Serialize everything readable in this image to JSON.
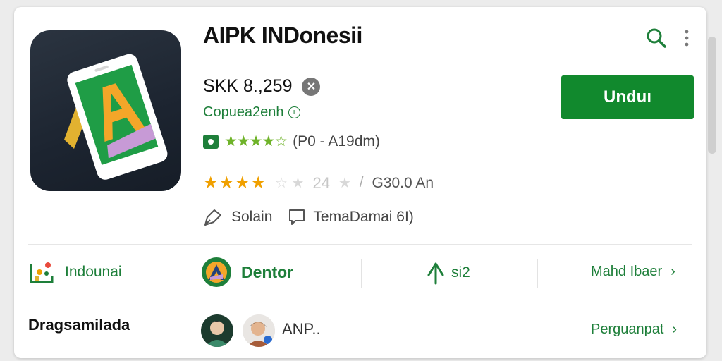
{
  "app": {
    "title": "AIPK INDonesii",
    "price": "SKK 8.,259",
    "developer": "Copuea2enh",
    "reviews": "(P0 - A19dm)",
    "rating_faint_number": "24",
    "downloads": "G30.0 An",
    "install_label": "Unduı"
  },
  "actions": {
    "share_label": "Solain",
    "comment_label": "TemaDamai 6I)"
  },
  "stats": {
    "item1_label": "Indounai",
    "item2_label": "Dentor",
    "item3_label": "si2",
    "more_label": "Mahd Ibaer"
  },
  "section": {
    "title": "Dragsamilada",
    "avatar_text": "ANP..",
    "more_label": "Perguanpat"
  },
  "colors": {
    "accent_green": "#11892d",
    "link_green": "#1e7f3a",
    "star_orange": "#f0a000",
    "star_green": "#6fb32a"
  },
  "icons": [
    "search-icon",
    "more-vert-icon",
    "close-icon",
    "info-icon",
    "share-icon",
    "comment-icon",
    "chevron-right-icon"
  ]
}
